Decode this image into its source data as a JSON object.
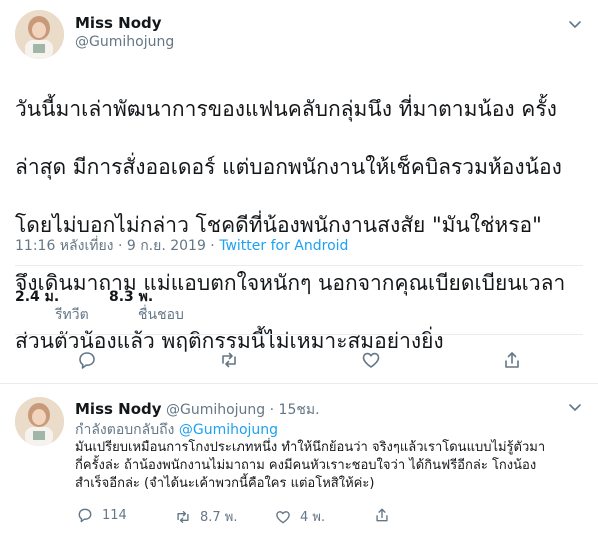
{
  "main_tweet": {
    "author_name": "Miss Nody",
    "author_handle": "@Gumihojung",
    "text_lines": [
      "วันนี้มาเล่าพัฒนาการของแฟนคลับกลุ่มนึง ที่มาตามน้อง ครั้ง",
      "ล่าสุด มีการสั่งออเดอร์ แต่บอกพนักงานให้เช็คบิลรวมห้องน้อง",
      "โดยไม่บอกไม่กล่าว โชคดีที่น้องพนักงานสงสัย \"มันใช่หรอ\"",
      "จึงเดินมาถาม แม่แอบตกใจหนักๆ นอกจากคุณเบียดเบียนเวลา",
      "ส่วนตัวน้องแล้ว พฤติกรรมนี้ไม่เหมาะสมอย่างยิ่ง"
    ],
    "timestamp": "11:16 หลังเที่ยง · 9 ก.ย. 2019 · ",
    "source": "Twitter for Android",
    "retweets_value": "2.4 ม.",
    "retweets_label": "รีทวีต",
    "likes_value": "8.3 พ.",
    "likes_label": "ชื่นชอบ"
  },
  "reply_tweet": {
    "author_name": "Miss Nody",
    "author_handle": "@Gumihojung · 15ชม.",
    "replying_prefix": "กำลังตอบกลับถึง ",
    "replying_mention": "@Gumihojung",
    "text_lines": [
      "มันเปรียบเหมือนการโกงประเภทหนึ่ง ทำให้นึกย้อนว่า จริงๆแล้วเราโดนแบบไม่รู้ตัวมา",
      "กี่ครั้งล่ะ ถ้าน้องพนักงานไม่มาถาม คงมีคนหัวเราะชอบใจว่า ได้กินฟรีอีกล่ะ โกงน้อง",
      "สำเร็จอีกล่ะ  (จำได้นะเค้าพวกนี้คือใคร แต่อโหสิให้ค่ะ)"
    ],
    "reply_count": "114",
    "retweet_count": "8.7 พ.",
    "like_count": "4 พ."
  },
  "colors": {
    "accent": "#1da1f2",
    "secondary_text": "#657786",
    "primary_text": "#14171a",
    "divider": "#e6ecf0"
  },
  "icons": [
    "chevron-down-icon",
    "reply-icon",
    "retweet-icon",
    "like-icon",
    "share-icon"
  ]
}
